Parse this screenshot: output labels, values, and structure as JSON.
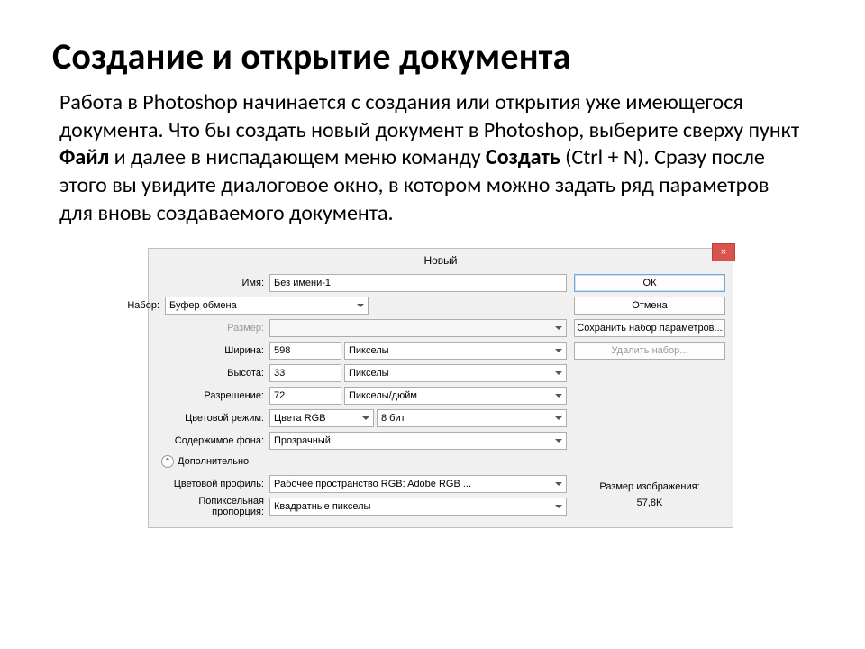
{
  "title": "Создание и открытие документа",
  "body": {
    "p1": "Работа в Photoshop начинается с создания или открытия уже имеющегося документа. Что бы создать новый документ в Photoshop, выберите сверху пункт ",
    "p2": "Файл",
    "p3": " и далее в ниспадающем меню команду  ",
    "p4": "Создать",
    "p5": " (Ctrl + N). Сразу после этого вы увидите диалоговое окно, в котором можно задать ряд параметров для вновь создаваемого документа."
  },
  "dialog": {
    "close": "×",
    "title": "Новый",
    "labels": {
      "name": "Имя:",
      "preset": "Набор:",
      "size": "Размер:",
      "width": "Ширина:",
      "height": "Высота:",
      "resolution": "Разрешение:",
      "colormode": "Цветовой режим:",
      "background": "Содержимое фона:",
      "advanced": "Дополнительно",
      "profile": "Цветовой профиль:",
      "pixelaspect": "Попиксельная пропорция:"
    },
    "values": {
      "name": "Без имени-1",
      "preset": "Буфер обмена",
      "size": "",
      "width": "598",
      "width_unit": "Пикселы",
      "height": "33",
      "height_unit": "Пикселы",
      "resolution": "72",
      "resolution_unit": "Пикселы/дюйм",
      "colormode": "Цвета RGB",
      "bits": "8 бит",
      "background": "Прозрачный",
      "profile": "Рабочее пространство RGB:  Adobe RGB ...",
      "pixelaspect": "Квадратные пикселы"
    },
    "buttons": {
      "ok": "ОК",
      "cancel": "Отмена",
      "savepreset": "Сохранить набор параметров...",
      "deletepreset": "Удалить набор..."
    },
    "info": {
      "label": "Размер изображения:",
      "value": "57,8K"
    }
  }
}
